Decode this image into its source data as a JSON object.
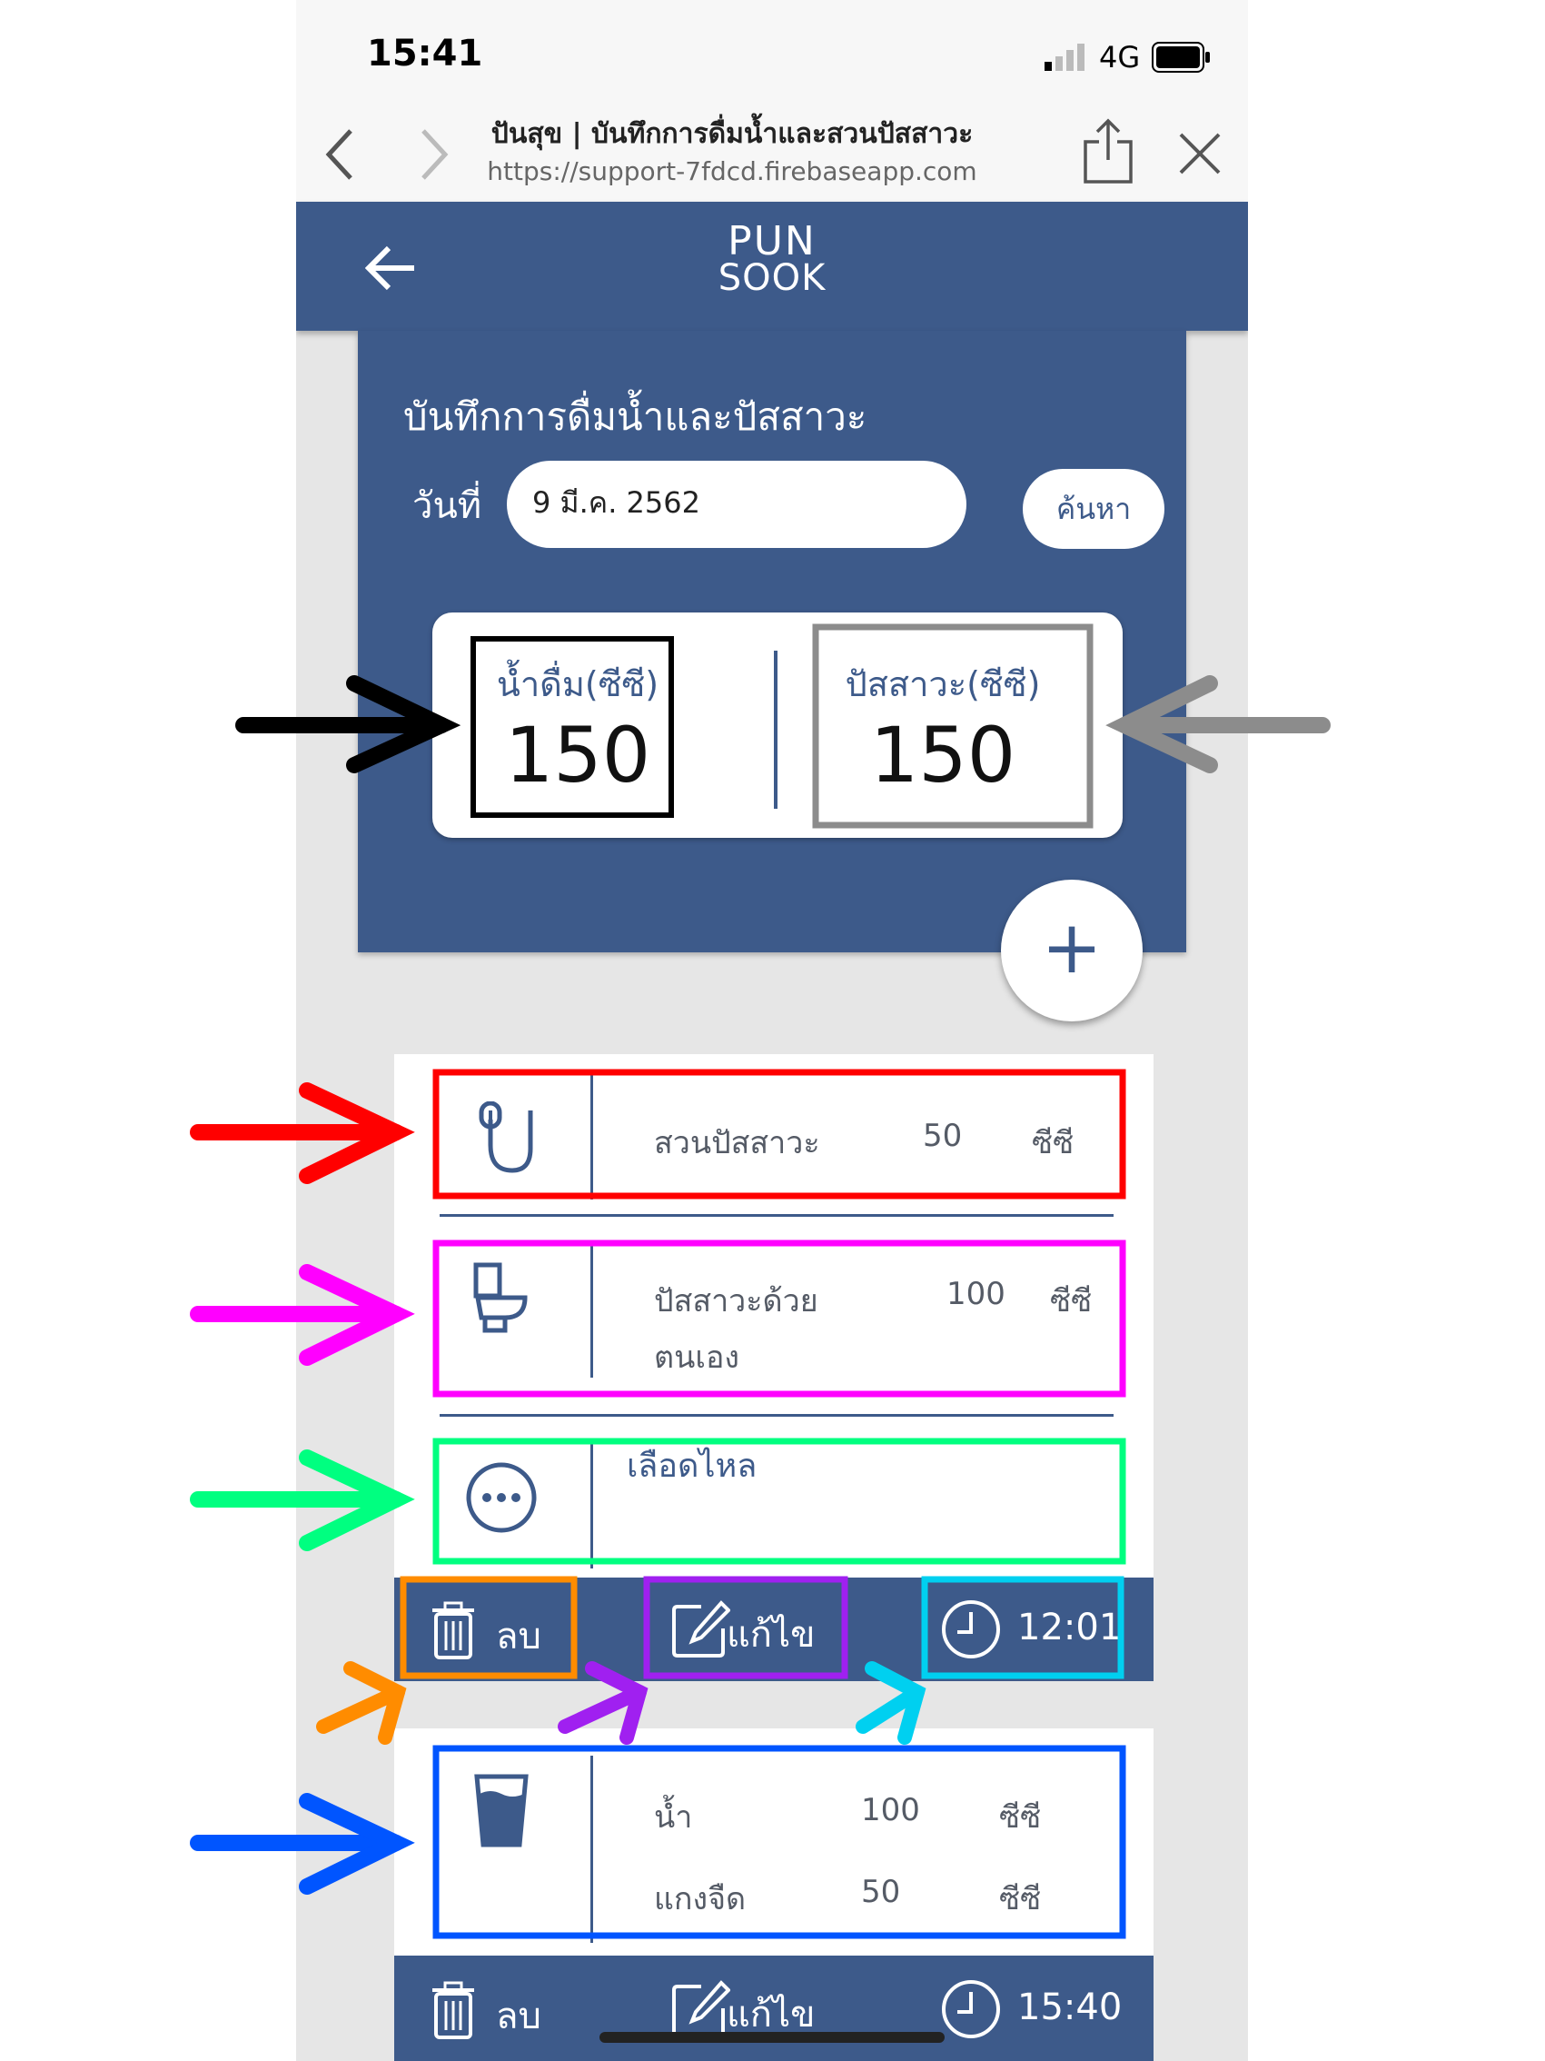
{
  "status_bar": {
    "time": "15:41",
    "network": "4G"
  },
  "browser": {
    "page_title": "ปันสุข | บันทึกการดื่มน้ำและสวนปัสสาวะ",
    "url": "https://support-7fdcd.firebaseapp.com"
  },
  "app": {
    "logo_line1": "PUN",
    "logo_line2": "SOOK",
    "heading": "บันทึกการดื่มน้ำและปัสสาวะ",
    "date_label": "วันที่",
    "date_value": "9 มี.ค. 2562",
    "search_label": "ค้นหา"
  },
  "summary": {
    "drink_label": "น้ำดื่ม(ซีซี)",
    "drink_value": "150",
    "urine_label": "ปัสสาวะ(ซีซี)",
    "urine_value": "150"
  },
  "add_button": "+",
  "record1": {
    "catheter": {
      "label": "สวนปัสสาวะ",
      "amount": "50",
      "unit": "ซีซี"
    },
    "self_urine": {
      "label_line1": "ปัสสาวะด้วย",
      "label_line2": "ตนเอง",
      "amount": "100",
      "unit": "ซีซี"
    },
    "note": {
      "text": "เลือดไหล"
    },
    "actions": {
      "delete": "ลบ",
      "edit": "แก้ไข",
      "time": "12:01"
    }
  },
  "record2": {
    "rows": [
      {
        "label": "น้ำ",
        "amount": "100",
        "unit": "ซีซี"
      },
      {
        "label": "แกงจืด",
        "amount": "50",
        "unit": "ซีซี"
      }
    ],
    "actions": {
      "delete": "ลบ",
      "edit": "แก้ไข",
      "time": "15:40"
    }
  },
  "colors": {
    "navy": "#3d5a8a",
    "annotation_black": "#000000",
    "annotation_gray": "#8c8c8c",
    "annotation_red": "#ff0000",
    "annotation_magenta": "#ff00ff",
    "annotation_green": "#00ff80",
    "annotation_orange": "#ff8c00",
    "annotation_purple": "#a020f0",
    "annotation_cyan": "#00d0f0",
    "annotation_blue": "#0055ff"
  }
}
